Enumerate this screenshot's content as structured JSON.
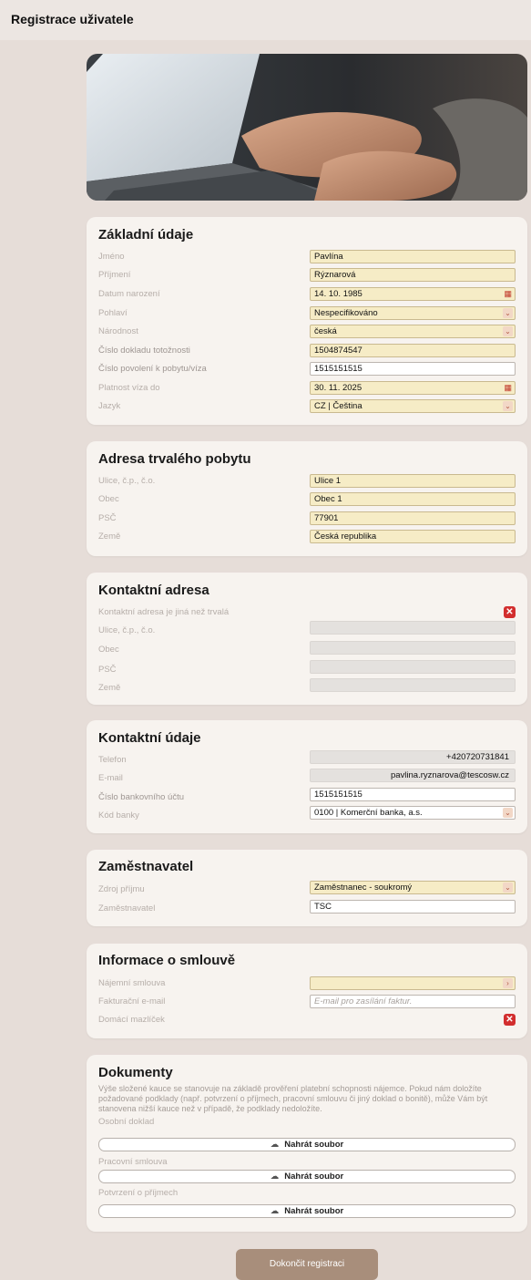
{
  "page_title": "Registrace uživatele",
  "sections": {
    "basic": {
      "title": "Základní údaje",
      "fields": [
        {
          "label": "Jméno",
          "value": "Pavlína"
        },
        {
          "label": "Příjmení",
          "value": "Rýznarová"
        },
        {
          "label": "Datum narození",
          "value": "14. 10. 1985",
          "icon": "calendar-icon"
        },
        {
          "label": "Pohlaví",
          "value": "Nespecifikováno",
          "icon": "chevron-down-icon"
        },
        {
          "label": "Národnost",
          "value": "česká",
          "icon": "chevron-down-icon"
        },
        {
          "label": "Číslo dokladu totožnosti",
          "value": "1504874547"
        },
        {
          "label": "Číslo povolení k pobytu/víza",
          "value": "1515151515"
        },
        {
          "label": "Platnost víza do",
          "value": "30. 11. 2025",
          "icon": "calendar-icon"
        },
        {
          "label": "Jazyk",
          "value": "CZ | Čeština",
          "icon": "chevron-down-icon"
        }
      ]
    },
    "address": {
      "title": "Adresa trvalého pobytu",
      "fields": [
        {
          "label": "Ulice, č.p., č.o.",
          "value": "Ulice 1"
        },
        {
          "label": "Obec",
          "value": "Obec 1"
        },
        {
          "label": "PSČ",
          "value": "77901"
        },
        {
          "label": "Země",
          "value": "Česká republika"
        }
      ]
    },
    "contact_address": {
      "title": "Kontaktní adresa",
      "toggle_label": "Kontaktní adresa je jiná než trvalá",
      "fields": [
        {
          "label": "Ulice, č.p., č.o.",
          "value": ""
        },
        {
          "label": "Obec",
          "value": ""
        },
        {
          "label": "PSČ",
          "value": ""
        },
        {
          "label": "Země",
          "value": ""
        }
      ]
    },
    "contact": {
      "title": "Kontaktní údaje",
      "fields": [
        {
          "label": "Telefon",
          "value": "+420720731841"
        },
        {
          "label": "E-mail",
          "value": "pavlina.ryznarova@tescosw.cz"
        },
        {
          "label": "Číslo bankovního účtu",
          "value": "1515151515"
        },
        {
          "label": "Kód banky",
          "value": "0100 | Komerční banka, a.s.",
          "icon": "chevron-down-icon"
        }
      ]
    },
    "employer": {
      "title": "Zaměstnavatel",
      "fields": [
        {
          "label": "Zdroj příjmu",
          "value": "Zaměstnanec - soukromý",
          "icon": "chevron-down-icon"
        },
        {
          "label": "Zaměstnavatel",
          "value": "TSC"
        }
      ]
    },
    "contract": {
      "title": "Informace o smlouvě",
      "fields": [
        {
          "label": "Nájemní smlouva",
          "value": "",
          "icon": "chevron-right-icon"
        },
        {
          "label": "Fakturační e-mail",
          "value": "",
          "placeholder": "E-mail pro zasílání faktur."
        },
        {
          "label": "Domácí mazlíček",
          "value": ""
        }
      ]
    },
    "documents": {
      "title": "Dokumenty",
      "description": "Výše složené kauce se stanovuje na základě prověření platební schopnosti nájemce. Pokud nám doložíte požadované podklady (např. potvrzení o příjmech, pracovní smlouvu či jiný doklad o bonitě), může Vám být stanovena nižší kauce než v případě, že podklady nedoložíte.",
      "uploads": [
        {
          "label": "Osobní doklad",
          "button": "Nahrát soubor"
        },
        {
          "label": "Pracovní smlouva",
          "button": "Nahrát soubor"
        },
        {
          "label": "Potvrzení o příjmech",
          "button": "Nahrát soubor"
        }
      ]
    }
  },
  "submit_label": "Dokončit registraci",
  "colors": {
    "accent": "#a88e7b",
    "field_fill": "#f6ecc6",
    "error": "#d22e2e"
  }
}
